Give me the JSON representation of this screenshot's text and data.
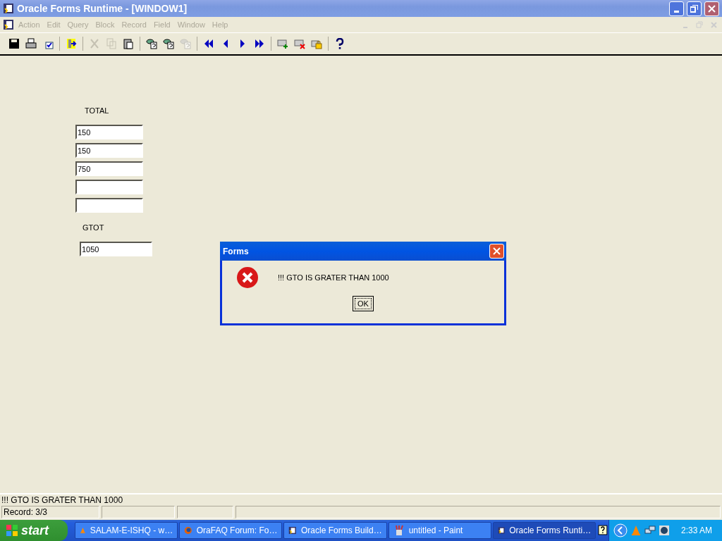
{
  "window": {
    "title": "Oracle Forms Runtime - [WINDOW1]"
  },
  "menu": [
    {
      "label": "Action",
      "disabled": true
    },
    {
      "label": "Edit",
      "disabled": true
    },
    {
      "label": "Query",
      "disabled": true
    },
    {
      "label": "Block",
      "disabled": true
    },
    {
      "label": "Record",
      "disabled": true
    },
    {
      "label": "Field",
      "disabled": true
    },
    {
      "label": "Window",
      "disabled": true
    },
    {
      "label": "Help",
      "disabled": true
    }
  ],
  "toolbar": [
    [
      {
        "kind": "save",
        "disabled": false
      },
      {
        "kind": "print",
        "disabled": false
      },
      {
        "kind": "commit",
        "disabled": false
      }
    ],
    [
      {
        "kind": "exit",
        "disabled": false
      }
    ],
    [
      {
        "kind": "cut",
        "disabled": true
      },
      {
        "kind": "copy",
        "disabled": true
      },
      {
        "kind": "paste",
        "disabled": false
      }
    ],
    [
      {
        "kind": "query",
        "disabled": false
      },
      {
        "kind": "execute",
        "disabled": false
      },
      {
        "kind": "cancel",
        "disabled": true
      }
    ],
    [
      {
        "kind": "first",
        "disabled": false
      },
      {
        "kind": "prev",
        "disabled": false
      },
      {
        "kind": "next",
        "disabled": false
      },
      {
        "kind": "last",
        "disabled": false
      }
    ],
    [
      {
        "kind": "insert",
        "disabled": false
      },
      {
        "kind": "delete",
        "disabled": false
      },
      {
        "kind": "lock",
        "disabled": false
      }
    ],
    [
      {
        "kind": "help",
        "disabled": false
      }
    ]
  ],
  "form": {
    "total": {
      "label": "TOTAL",
      "rows": [
        {
          "value": "150"
        },
        {
          "value": "150"
        },
        {
          "value": "750"
        },
        {},
        {}
      ]
    },
    "gtot": {
      "label": "GTOT",
      "value": "1050"
    }
  },
  "dialog": {
    "title": "Forms",
    "message": "!!! GTO IS GRATER THAN 1000",
    "button": "OK"
  },
  "message_line": "!!! GTO IS GRATER THAN 1000",
  "status_bar": {
    "record": "Record: 3/3"
  },
  "taskbar": {
    "start": "start",
    "items": [
      {
        "label": "SALAM-E-ISHQ - w…",
        "kind": "vlc",
        "selected": false
      },
      {
        "label": "OraFAQ Forum: Fo…",
        "kind": "firefox",
        "selected": false
      },
      {
        "label": "Oracle Forms Build…",
        "kind": "oracle",
        "selected": false
      },
      {
        "label": "untitled - Paint",
        "kind": "paint",
        "selected": false
      },
      {
        "label": "Oracle Forms Runti…",
        "kind": "oracle",
        "selected": true
      }
    ],
    "clock": "2:33 AM"
  }
}
